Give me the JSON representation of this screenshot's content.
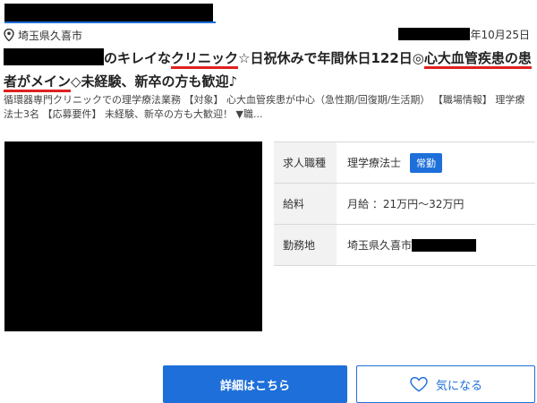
{
  "location": {
    "text": "埼玉県久喜市"
  },
  "date": {
    "text": "年10月25日"
  },
  "title": {
    "part1": "のキレイな",
    "part2_underlined": "クリニック",
    "part3": "☆日祝休みで年間休日122日◎",
    "part4_underlined": "心大血管疾患の患",
    "part5_underlined": "者がメイン",
    "part6": "◇未経験、新卒の方も歓迎♪"
  },
  "description": "循環器専門クリニックでの理学療法業務 【対象】 心大血管疾患が中心（急性期/回復期/生活期） 【職場情報】 理学療法士3名 【応募要件】 未経験、新卒の方も大歓迎！ ▼職...",
  "info": {
    "job_type": {
      "label": "求人職種",
      "value": "理学療法士",
      "badge": "常勤"
    },
    "salary": {
      "label": "給料",
      "value": "月給 ：21万円〜32万円"
    },
    "workplace": {
      "label": "勤務地",
      "value": "埼玉県久喜市"
    }
  },
  "buttons": {
    "detail": "詳細はこちら",
    "favorite": "気になる"
  },
  "colors": {
    "accent": "#1e6fd9",
    "underline": "#e02020"
  },
  "icons": {
    "location": "map-pin-icon",
    "favorite": "heart-icon"
  }
}
